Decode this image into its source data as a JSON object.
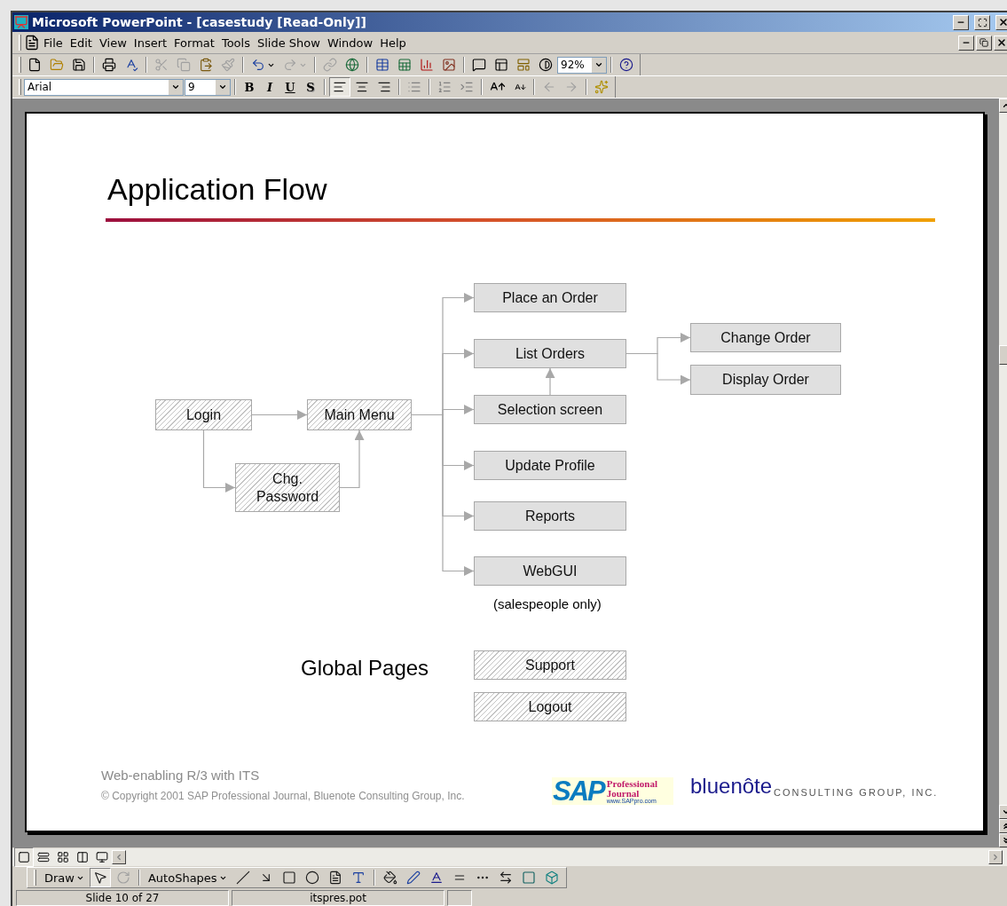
{
  "window": {
    "title": "Microsoft PowerPoint - [casestudy [Read-Only]]"
  },
  "menu": [
    "File",
    "Edit",
    "View",
    "Insert",
    "Format",
    "Tools",
    "Slide Show",
    "Window",
    "Help"
  ],
  "standard_toolbar": {
    "buttons": [
      {
        "disabled": false
      },
      {
        "disabled": false
      },
      {
        "disabled": false
      },
      {
        "disabled": false
      },
      {
        "disabled": false
      },
      {
        "disabled": true
      },
      {
        "disabled": true
      },
      {
        "disabled": false
      },
      {
        "disabled": true
      },
      {
        "disabled": false
      },
      {
        "disabled": true
      },
      {
        "disabled": true
      },
      {
        "disabled": false
      },
      {
        "disabled": false
      },
      {
        "disabled": false
      },
      {
        "disabled": false
      },
      {
        "disabled": false
      },
      {
        "disabled": false
      },
      {
        "disabled": false
      },
      {
        "disabled": false
      },
      {
        "disabled": false
      }
    ],
    "zoom": "92%"
  },
  "formatting_toolbar": {
    "font": "Arial",
    "size": "9",
    "styles": [
      "B",
      "I",
      "U",
      "S"
    ]
  },
  "slide": {
    "title": "Application Flow",
    "nodes": [
      {
        "label": "Login",
        "kind": "hatched"
      },
      {
        "label": "Main Menu",
        "kind": "hatched"
      },
      {
        "label": "Chg. Password",
        "kind": "hatched"
      },
      {
        "label": "Place an Order",
        "kind": "plain"
      },
      {
        "label": "List Orders",
        "kind": "plain"
      },
      {
        "label": "Selection screen",
        "kind": "plain"
      },
      {
        "label": "Update Profile",
        "kind": "plain"
      },
      {
        "label": "Reports",
        "kind": "plain"
      },
      {
        "label": "WebGUI",
        "kind": "plain"
      },
      {
        "label": "Change Order",
        "kind": "plain"
      },
      {
        "label": "Display Order",
        "kind": "plain"
      }
    ],
    "note": "(salespeople only)",
    "global_label": "Global Pages",
    "global_pages": [
      {
        "label": "Support",
        "kind": "hatched"
      },
      {
        "label": "Logout",
        "kind": "hatched"
      }
    ],
    "footer": {
      "title": "Web-enabling R/3 with ITS",
      "copyright": "© Copyright 2001 SAP Professional Journal, Bluenote Consulting Group, Inc."
    },
    "logos": {
      "sap": "SAP",
      "sap_name": [
        "Professional",
        "Journal"
      ],
      "sap_url": "www.SAPpro.com",
      "bluenote": "bluenôte",
      "bluenote_tag": "CONSULTING GROUP, INC."
    }
  },
  "drawing_toolbar": {
    "draw": "Draw",
    "autoshapes": "AutoShapes"
  },
  "status_bar": [
    "Slide 10 of 27",
    "itspres.pot"
  ]
}
